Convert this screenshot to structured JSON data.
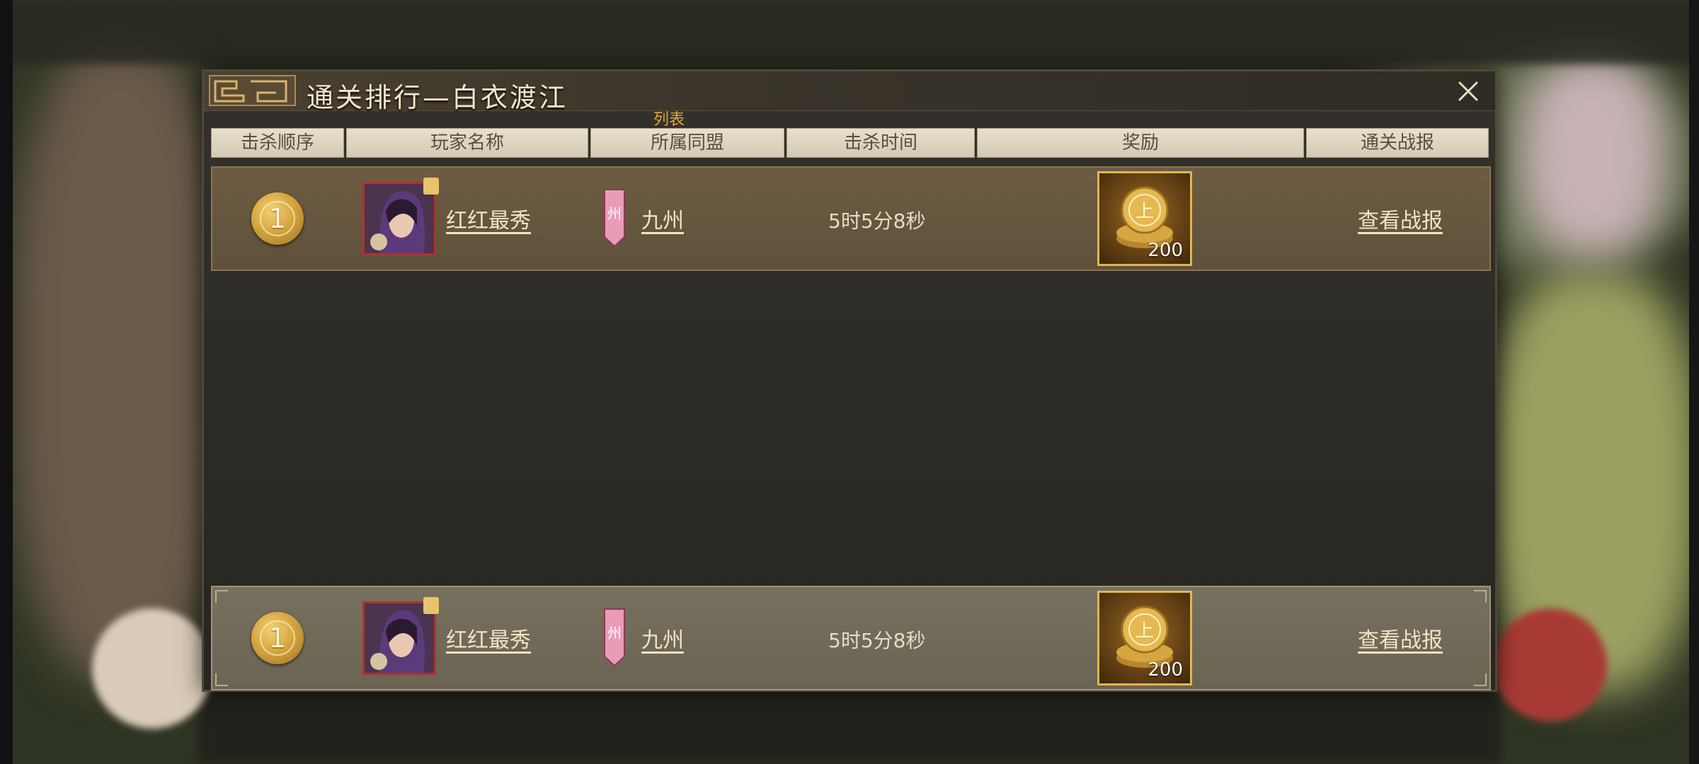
{
  "dialog": {
    "title": "通关排行—白衣渡江",
    "list_tag": "列表"
  },
  "columns": [
    "击杀顺序",
    "玩家名称",
    "所属同盟",
    "击杀时间",
    "奖励",
    "通关战报"
  ],
  "rows": [
    {
      "rank": "1",
      "player": "红红最秀",
      "alliance_badge": "州",
      "alliance": "九州",
      "time": "5时5分8秒",
      "reward_count": "200",
      "report_link": "查看战报"
    }
  ],
  "my_row": {
    "rank": "1",
    "player": "红红最秀",
    "alliance_badge": "州",
    "alliance": "九州",
    "time": "5时5分8秒",
    "reward_count": "200",
    "report_link": "查看战报"
  },
  "icons": {
    "close": "close-icon",
    "rank": "gold-medal-icon",
    "reward": "coin-pile-icon",
    "alliance": "banner-icon",
    "avatar": "player-portrait"
  },
  "colors": {
    "title": "#f2e6c8",
    "list_tag": "#e0a83a",
    "reward_border": "#e3b64c",
    "avatar_border": "#b0322b",
    "banner": "#e89cb8"
  }
}
